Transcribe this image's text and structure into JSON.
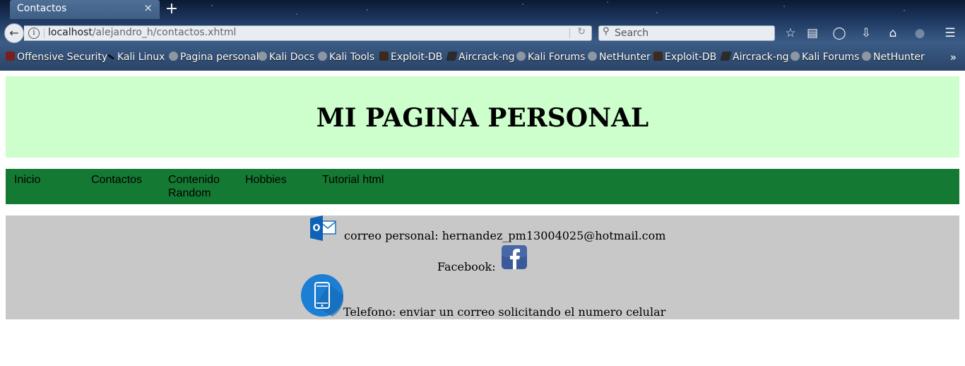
{
  "browser": {
    "tab_title": "Contactos",
    "tab_close": "×",
    "new_tab": "+",
    "url_host": "localhost",
    "url_path": "/alejandro_h/contactos.xhtml",
    "search_placeholder": "Search",
    "bookmarks": [
      "Offensive Security",
      "Kali Linux",
      "Pagina personal",
      "Kali Docs",
      "Kali Tools",
      "Exploit-DB",
      "Aircrack-ng",
      "Kali Forums",
      "NetHunter",
      "Exploit-DB",
      "Aircrack-ng",
      "Kali Forums",
      "NetHunter"
    ],
    "bookmarks_more": "»"
  },
  "page": {
    "title": "MI PAGINA PERSONAL",
    "menu": [
      "Inicio",
      "Contactos",
      "Contenido Random",
      "Hobbies",
      "Tutorial html"
    ],
    "contact": {
      "email_text": "correo personal: hernandez_pm13004025@hotmail.com",
      "facebook_text": "Facebook:",
      "phone_text": "Telefono: enviar un correo solicitando el numero celular"
    }
  },
  "icons": {
    "outlook": "outlook-icon",
    "facebook": "facebook-icon",
    "phone": "phone-icon"
  },
  "colors": {
    "header_bg": "#ccffcc",
    "menu_bg": "#147a33",
    "contact_bg": "#c8c8c8"
  }
}
